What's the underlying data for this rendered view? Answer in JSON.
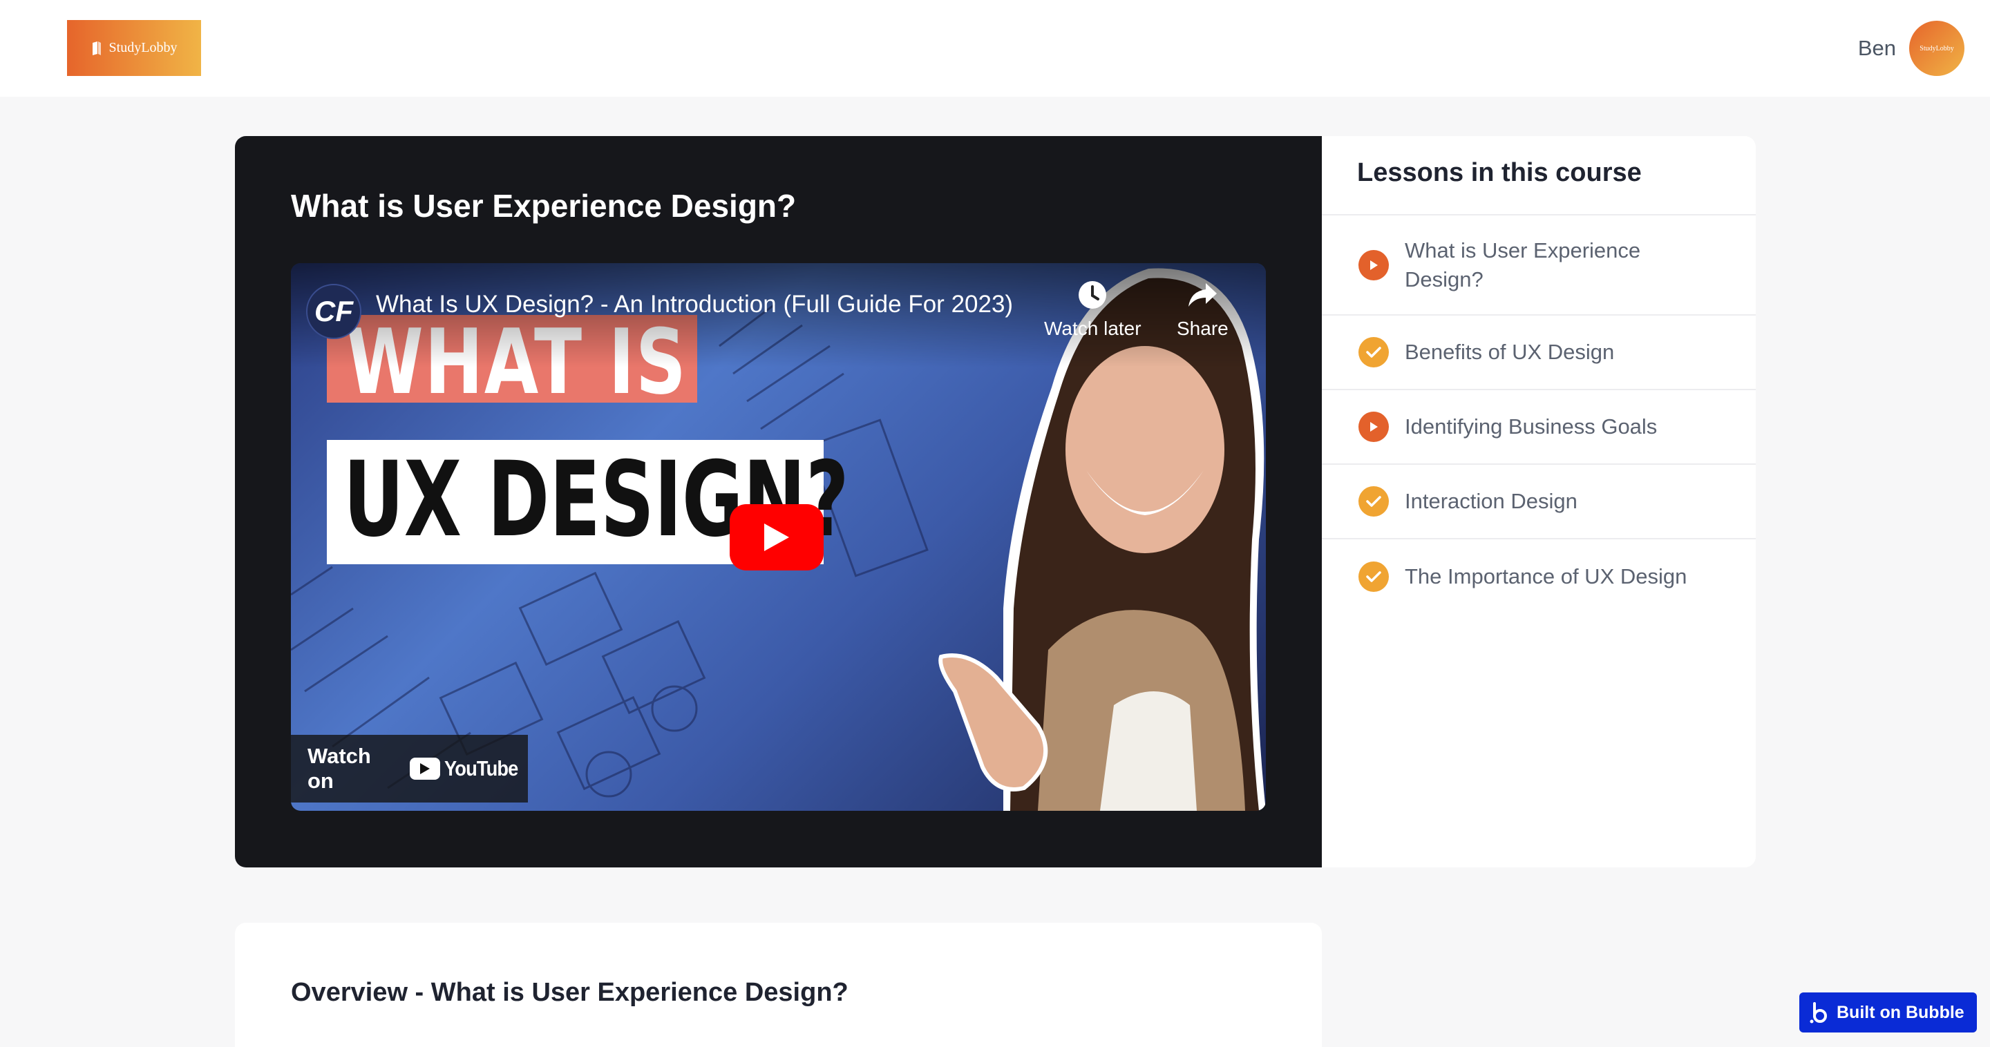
{
  "header": {
    "logo_text": "StudyLobby",
    "user_name": "Ben",
    "avatar_text": "StudyLobby"
  },
  "lesson": {
    "title": "What is User Experience Design?"
  },
  "video": {
    "channel_initials": "CF",
    "title": "What Is UX Design? - An Introduction (Full Guide For 2023)",
    "thumbnail_line1": "WHAT IS",
    "thumbnail_line2": "UX DESIGN?",
    "watch_later_label": "Watch later",
    "share_label": "Share",
    "watch_on_label": "Watch on",
    "youtube_label": "YouTube"
  },
  "lessons_panel": {
    "heading": "Lessons in this course",
    "items": [
      {
        "label": "What is User Experience Design?",
        "status": "play"
      },
      {
        "label": "Benefits of UX Design",
        "status": "done"
      },
      {
        "label": "Identifying Business Goals",
        "status": "play"
      },
      {
        "label": "Interaction Design",
        "status": "done"
      },
      {
        "label": "The Importance of UX Design",
        "status": "done"
      }
    ]
  },
  "overview": {
    "title": "Overview - What is User Experience Design?"
  },
  "badge": {
    "label": "Built on Bubble"
  },
  "colors": {
    "brand_gradient_start": "#e6652b",
    "brand_gradient_end": "#f0b446",
    "play_status": "#e3612b",
    "done_status": "#f0a432",
    "video_panel_bg": "#16171b",
    "bubble_blue": "#0a2bd6",
    "youtube_red": "#ff0000"
  },
  "icons": {
    "logo": "book-icon",
    "watch_later": "clock-icon",
    "share": "share-arrow-icon",
    "play": "play-icon",
    "done": "check-icon",
    "bubble": "bubble-logo-icon"
  }
}
